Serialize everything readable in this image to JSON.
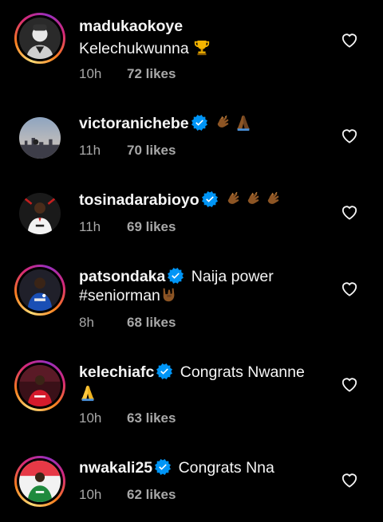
{
  "comments": [
    {
      "username": "madukaokoye",
      "verified": false,
      "text": "Kelechukwunna",
      "emoji": [
        "trophy"
      ],
      "time": "10h",
      "likes": "72 likes",
      "avatar_icon": "man-portrait-avatar"
    },
    {
      "username": "victoranichebe",
      "verified": true,
      "text": "",
      "emoji": [
        "clapping-hands",
        "folded-hands"
      ],
      "time": "11h",
      "likes": "70 likes",
      "avatar_icon": "city-skyline-avatar"
    },
    {
      "username": "tosinadarabioyo",
      "verified": true,
      "text": "",
      "emoji": [
        "clapping-hands",
        "clapping-hands",
        "clapping-hands"
      ],
      "time": "11h",
      "likes": "69 likes",
      "avatar_icon": "player-white-kit-avatar"
    },
    {
      "username": "patsondaka",
      "verified": true,
      "text": "Naija power",
      "line2": "#seniorman",
      "emoji2": [
        "sign-of-horns"
      ],
      "time": "8h",
      "likes": "68 likes",
      "avatar_icon": "player-blue-kit-avatar"
    },
    {
      "username": "kelechiafc",
      "verified": true,
      "text": "Congrats Nwanne",
      "line2": "",
      "emoji2": [
        "folded-hands"
      ],
      "time": "10h",
      "likes": "63 likes",
      "avatar_icon": "player-red-kit-avatar"
    },
    {
      "username": "nwakali25",
      "verified": true,
      "text": "Congrats Nna",
      "emoji": [],
      "time": "10h",
      "likes": "62 likes",
      "avatar_icon": "player-green-kit-avatar"
    }
  ],
  "colors": {
    "background": "#000000",
    "text": "#f5f5f5",
    "secondary": "#a8a8a8",
    "verified": "#0095f6"
  }
}
